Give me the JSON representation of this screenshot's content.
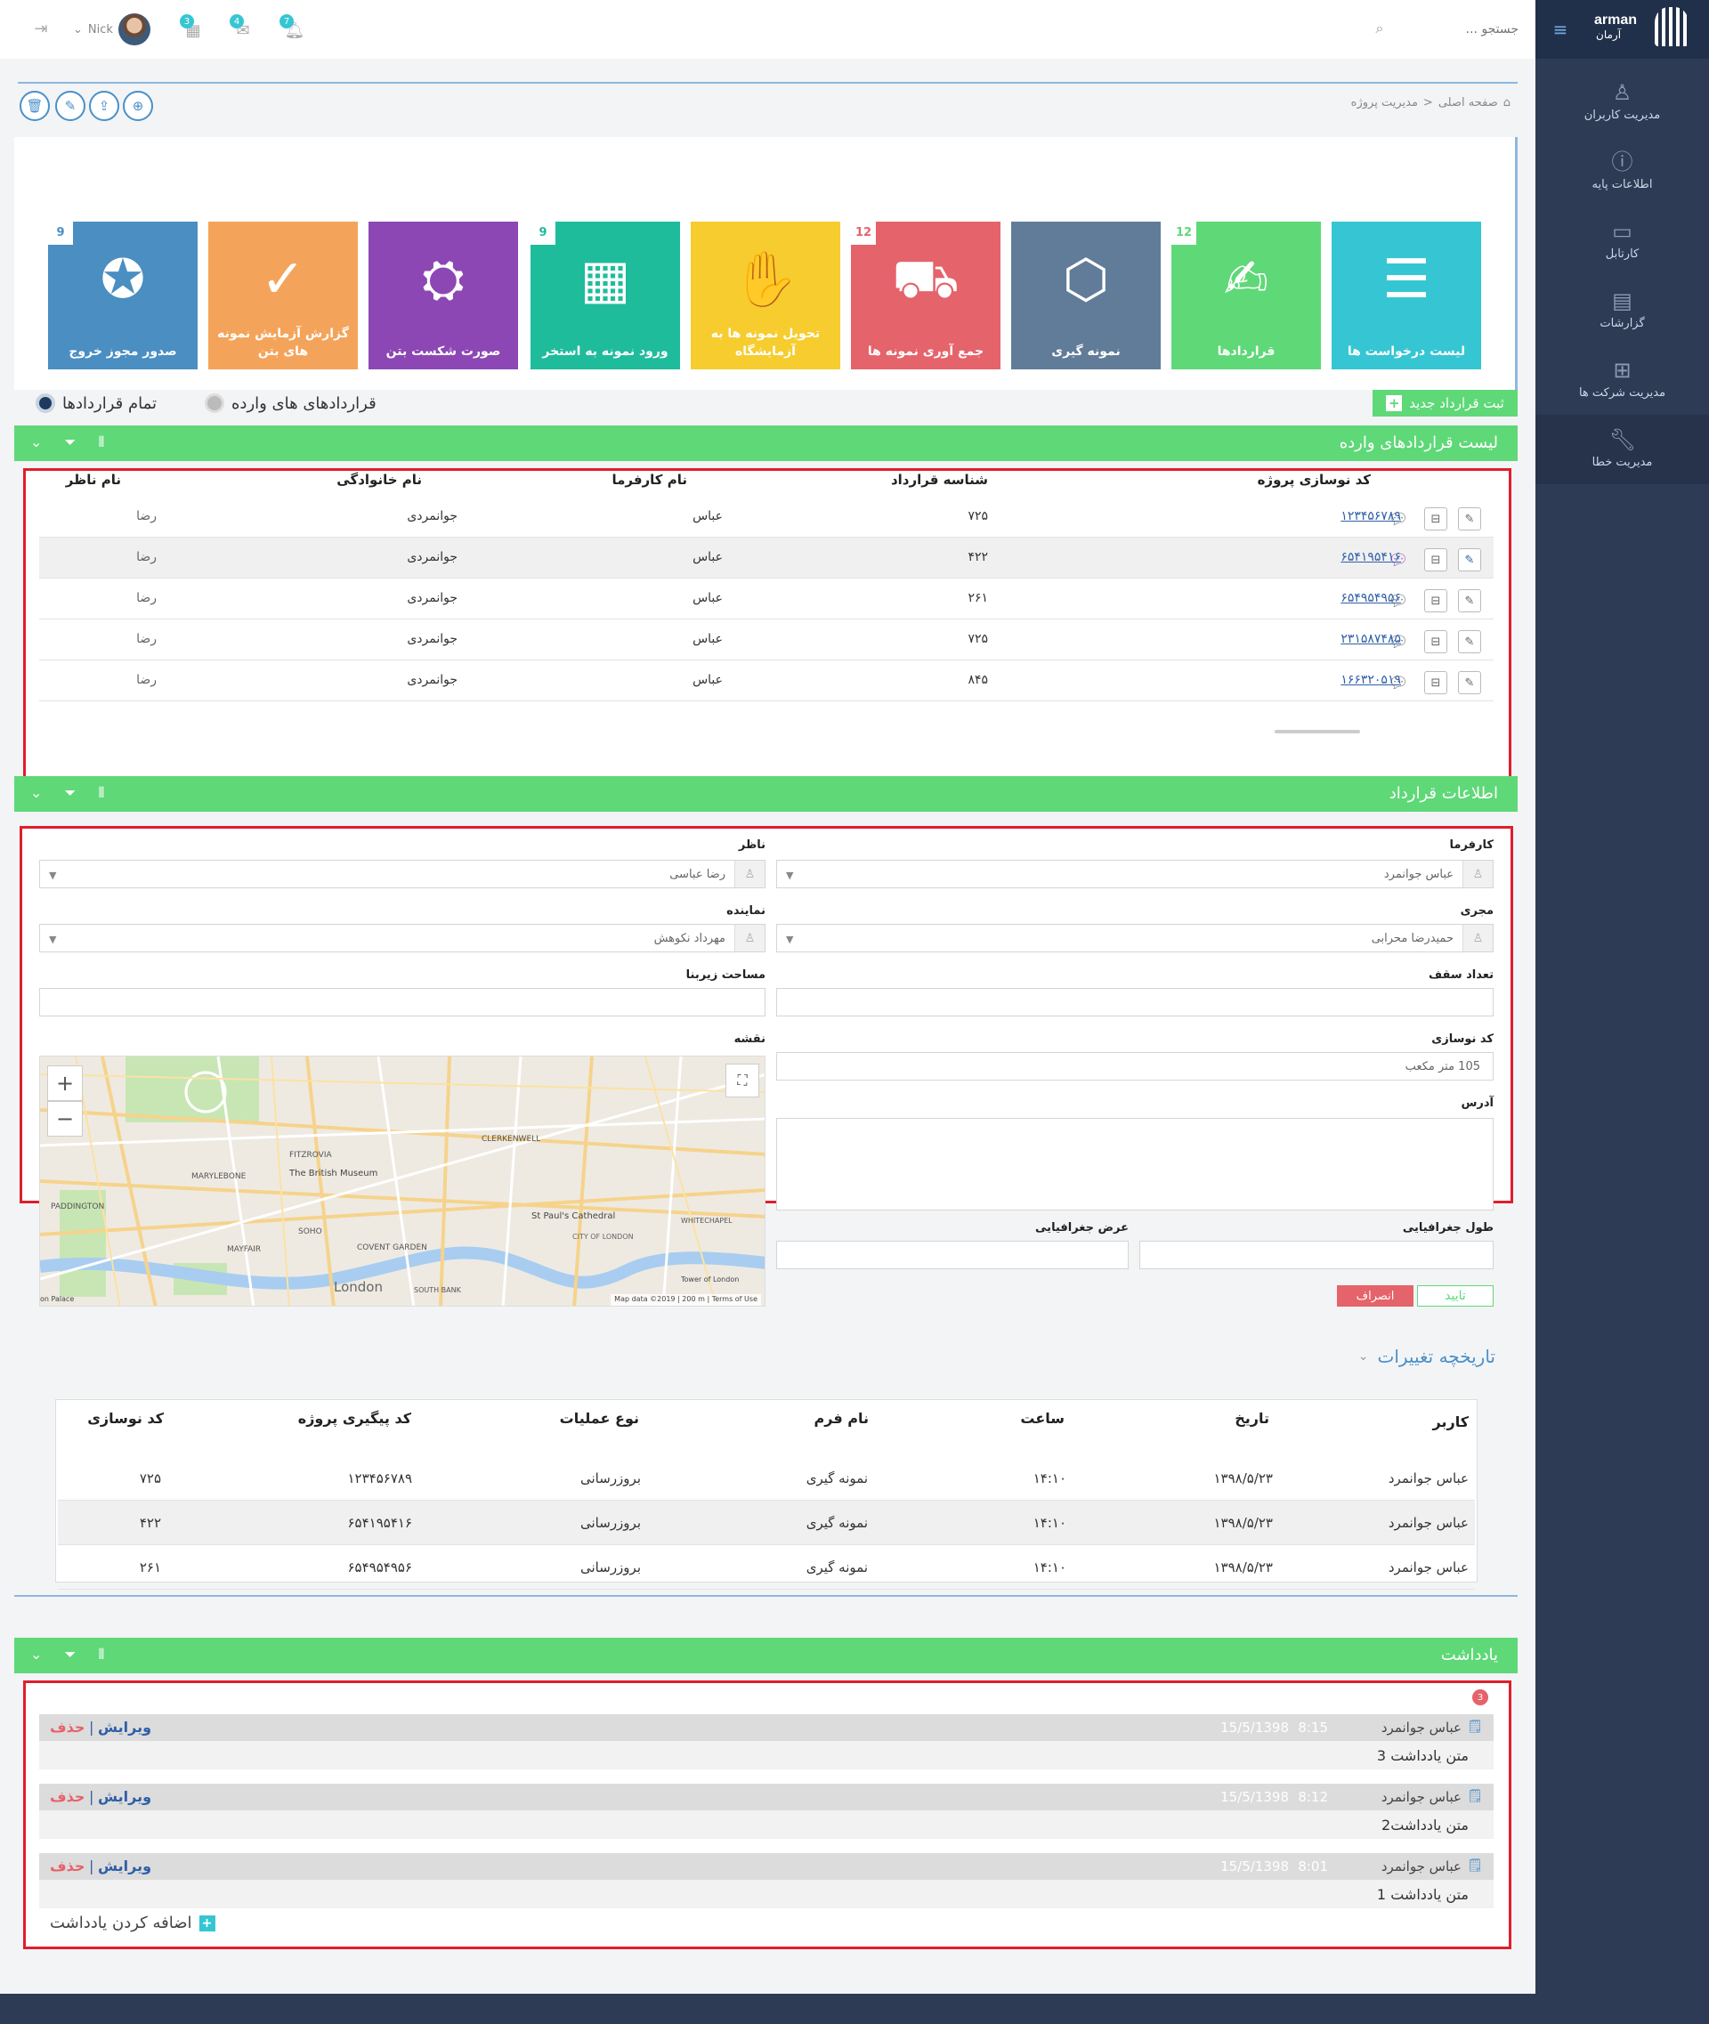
{
  "topbar": {
    "search_placeholder": "جستجو ...",
    "user_name": "Nick",
    "badges": {
      "calendar": "3",
      "mail": "4",
      "bell": "7"
    }
  },
  "brand": {
    "name": "arman",
    "name_fa": "آرمان"
  },
  "sidebar": {
    "items": [
      {
        "label": "مدیریت کاربران",
        "icon": "user-icon"
      },
      {
        "label": "اطلاعات پایه",
        "icon": "info-icon"
      },
      {
        "label": "کارتابل",
        "icon": "folder-icon"
      },
      {
        "label": "گزارشات",
        "icon": "book-icon"
      },
      {
        "label": "مدیریت شرکت ها",
        "icon": "grid-icon"
      },
      {
        "label": "مدیریت خطا",
        "icon": "wrench-icon"
      }
    ]
  },
  "breadcrumb": {
    "home": "صفحه اصلی",
    "separator": "<",
    "current": "مدیریت پروژه"
  },
  "tiles": [
    {
      "label": "لیست درخواست ها",
      "color": "#36c6d3",
      "badge": "",
      "icon": "list-doc-icon"
    },
    {
      "label": "قراردادها",
      "color": "#5fd878",
      "badge": "12",
      "icon": "contract-icon"
    },
    {
      "label": "نمونه گیری",
      "color": "#617c99",
      "badge": "",
      "icon": "shapes-icon"
    },
    {
      "label": "جمع آوری نمونه ها",
      "color": "#e5636a",
      "badge": "12",
      "icon": "truck-icon"
    },
    {
      "label": "تحویل نمونه ها به آزمایشگاه",
      "color": "#f6cc2f",
      "badge": "",
      "icon": "hand-box-icon"
    },
    {
      "label": "ورود نمونه به استخر",
      "color": "#1fbc9c",
      "badge": "9",
      "icon": "pool-icon"
    },
    {
      "label": "صورت شکست بتن",
      "color": "#8d47b4",
      "badge": "",
      "icon": "press-icon"
    },
    {
      "label": "گزارش آزمایش نمونه های بتن",
      "color": "#f4a45a",
      "badge": "",
      "icon": "report-icon"
    },
    {
      "label": "صدور مجوز خروج",
      "color": "#4a8ec2",
      "badge": "9",
      "icon": "award-icon"
    }
  ],
  "contracts": {
    "new_button": "ثبت قرارداد جدید",
    "radio_incoming": "قراردادهای های وارده",
    "radio_all": "تمام قراردادها",
    "title": "لیست قراردادهای وارده",
    "columns": [
      "کد نوسازی پروژه",
      "شناسه قرارداد",
      "نام کارفرما",
      "نام خانوادگی",
      "نام ناظر"
    ],
    "rows": [
      {
        "code": "۱۲۳۴۵۶۷۸۹",
        "id": "۷۲۵",
        "employer": "عباس",
        "family": "جوانمردی",
        "supervisor": "رضا"
      },
      {
        "code": "۶۵۴۱۹۵۴۱۶",
        "id": "۴۲۲",
        "employer": "عباس",
        "family": "جوانمردی",
        "supervisor": "رضا"
      },
      {
        "code": "۶۵۴۹۵۴۹۵۶",
        "id": "۲۶۱",
        "employer": "عباس",
        "family": "جوانمردی",
        "supervisor": "رضا"
      },
      {
        "code": "۲۳۱۵۸۷۴۸۵",
        "id": "۷۲۵",
        "employer": "عباس",
        "family": "جوانمردی",
        "supervisor": "رضا"
      },
      {
        "code": "۱۶۶۳۲۰۵۱۹",
        "id": "۸۴۵",
        "employer": "عباس",
        "family": "جوانمردی",
        "supervisor": "رضا"
      }
    ]
  },
  "contract_info": {
    "title": "اطلاعات قرارداد",
    "employer_label": "کارفرما",
    "employer_value": "عباس جوانمرد",
    "supervisor_label": "ناظر",
    "supervisor_value": "رضا عباسی",
    "executor_label": "مجری",
    "executor_value": "حمیدرضا محرابی",
    "representative_label": "نماینده",
    "representative_value": "مهرداد نکوهش",
    "floors_label": "تعداد سقف",
    "area_label": "مساحت زیربنا",
    "renovation_code_label": "کد نوسازی",
    "renovation_code_value": "105 متر مکعب",
    "map_label": "نقشه",
    "address_label": "آدرس",
    "longitude_label": "طول جغرافیایی",
    "latitude_label": "عرض جغرافیایی",
    "confirm": "تایید",
    "cancel": "انصراف",
    "map": {
      "zoom_in": "+",
      "zoom_out": "−",
      "fullscreen": "⛶",
      "labels": [
        "FITZROVIA",
        "The British Museum",
        "MARYLEBONE",
        "CLERKENWELL",
        "PADDINGTON",
        "SOHO",
        "MAYFAIR",
        "COVENT GARDEN",
        "St Paul's Cathedral",
        "CITY OF LONDON",
        "WHITECHAPEL",
        "London",
        "SOUTH BANK",
        "Tower of London",
        "on Palace"
      ],
      "attribution": "Map data ©2019 | 200 m | Terms of Use"
    }
  },
  "history": {
    "title": "تاریخچه تغییرات",
    "columns": [
      "کاربر",
      "تاریخ",
      "ساعت",
      "نام فرم",
      "نوع عملیات",
      "کد پیگیری پروژه",
      "کد نوسازی"
    ],
    "rows": [
      {
        "user": "عباس جوانمرد",
        "date": "۱۳۹۸/۵/۲۳",
        "time": "۱۴:۱۰",
        "form": "نمونه گیری",
        "op": "بروزرسانی",
        "track": "۱۲۳۴۵۶۷۸۹",
        "code": "۷۲۵"
      },
      {
        "user": "عباس جوانمرد",
        "date": "۱۳۹۸/۵/۲۳",
        "time": "۱۴:۱۰",
        "form": "نمونه گیری",
        "op": "بروزرسانی",
        "track": "۶۵۴۱۹۵۴۱۶",
        "code": "۴۲۲"
      },
      {
        "user": "عباس جوانمرد",
        "date": "۱۳۹۸/۵/۲۳",
        "time": "۱۴:۱۰",
        "form": "نمونه گیری",
        "op": "بروزرسانی",
        "track": "۶۵۴۹۵۴۹۵۶",
        "code": "۲۶۱"
      }
    ]
  },
  "notes": {
    "title": "یادداشت",
    "count": "3",
    "edit": "ویرایش",
    "delete": "حذف",
    "sep": "|",
    "add": "اضافه کردن یادداشت",
    "items": [
      {
        "author": "عباس جوانمرد",
        "time": "8:15",
        "date": "15/5/1398",
        "text": "متن یادداشت 3"
      },
      {
        "author": "عباس جوانمرد",
        "time": "8:12",
        "date": "15/5/1398",
        "text": "متن یادداشت2"
      },
      {
        "author": "عباس جوانمرد",
        "time": "8:01",
        "date": "15/5/1398",
        "text": "متن یادداشت 1"
      }
    ]
  }
}
